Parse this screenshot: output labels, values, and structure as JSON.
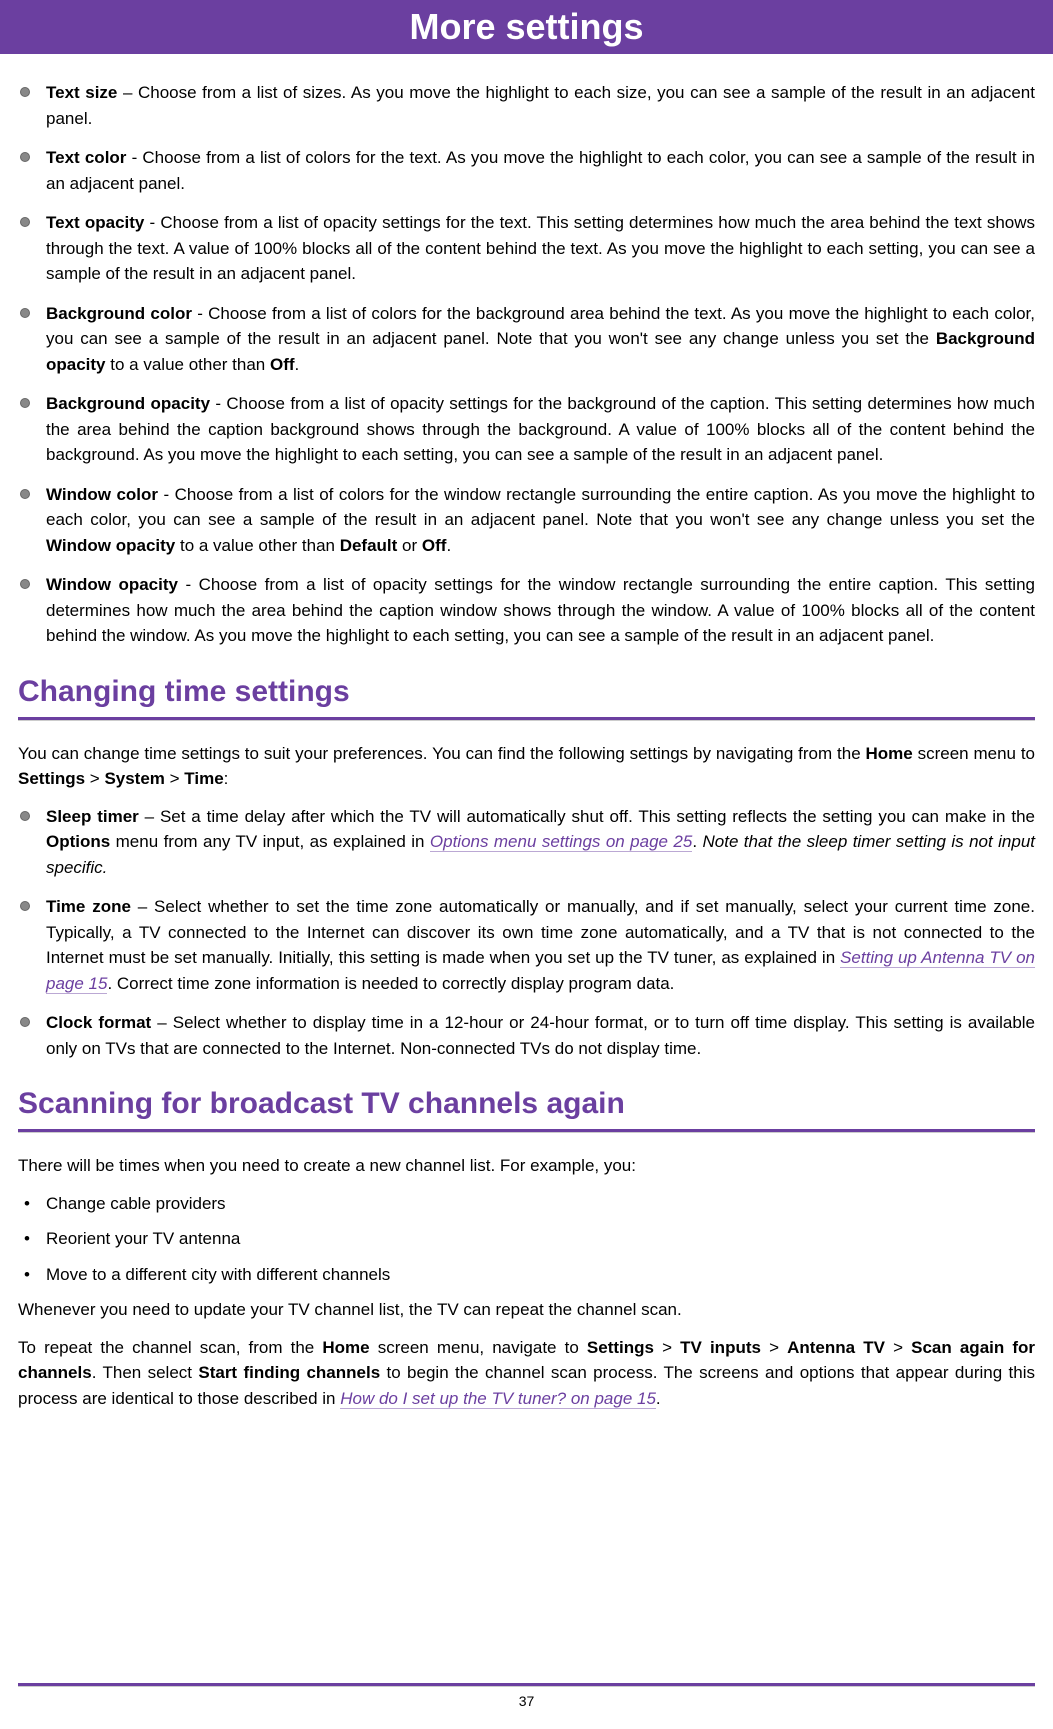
{
  "header": {
    "title": "More settings"
  },
  "section1": {
    "items": [
      {
        "term": "Text size",
        "sep": " – ",
        "body": "Choose from a list of sizes. As you move the highlight to each size, you can see a sample of the result in an adjacent panel."
      },
      {
        "term": "Text color",
        "sep": " - ",
        "body": "Choose from a list of colors for the text. As you move the highlight to each color, you can see a sample of the result in an adjacent panel."
      },
      {
        "term": "Text opacity",
        "sep": " - ",
        "body": "Choose from a list of opacity settings for the text. This setting determines how much the area behind the text shows through the text. A value of 100% blocks all of the content behind the text. As you move the highlight to each setting, you can see a sample of the result in an adjacent panel."
      },
      {
        "term": "Background color",
        "sep": " - ",
        "body1": "Choose from a list of colors for the background area behind the text. As you move the highlight to each color, you can see a sample of the result in an adjacent panel. Note that you won't see any change unless you set the ",
        "bold1": "Background opacity",
        "body2": " to a value other than ",
        "bold2": "Off",
        "body3": "."
      },
      {
        "term": "Background opacity",
        "sep": " - ",
        "body": "Choose from a list of opacity settings for the background of the caption. This setting determines how much the area behind the caption background shows through the background. A value of 100% blocks all of the content behind the background. As you move the highlight to each setting, you can see a sample of the result in an adjacent panel."
      },
      {
        "term": "Window color",
        "sep": " - ",
        "body1": "Choose from a list of colors for the window rectangle surrounding the entire caption. As you move the highlight to each color, you can see a sample of the result in an adjacent panel. Note that you won't see any change unless you set the ",
        "bold1": "Window opacity",
        "body2": " to a value other than ",
        "bold2": "Default",
        "body3": " or ",
        "bold3": "Off",
        "body4": "."
      },
      {
        "term": "Window opacity",
        "sep": " - ",
        "body": "Choose from a list of opacity settings for the window rectangle surrounding the entire caption. This setting determines how much the area behind the caption window shows through the window. A value of 100% blocks all of the content behind the window. As you move the highlight to each setting, you can see a sample of the result in an adjacent panel."
      }
    ]
  },
  "section2": {
    "heading": "Changing time settings",
    "intro1": "You can change time settings to suit your preferences. You can find the following settings by navigating from the ",
    "intro_bold1": "Home",
    "intro2": " screen menu to ",
    "intro_bold2": "Settings",
    "intro3": " > ",
    "intro_bold3": "System",
    "intro4": " > ",
    "intro_bold4": "Time",
    "intro5": ":",
    "items": [
      {
        "term": "Sleep timer",
        "sep": " – ",
        "body1": "Set a time delay after which the TV will automatically shut off. This setting reflects the setting you can make in the ",
        "bold1": "Options",
        "body2": " menu from any TV input, as explained in ",
        "link1": "Options menu settings on page 25",
        "body3": ". ",
        "ital1": "Note that the sleep timer setting is not input specific."
      },
      {
        "term": "Time zone",
        "sep": " – ",
        "body1": "Select whether to set the time zone automatically or manually, and if set manually, select your current time zone. Typically, a TV connected to the Internet can discover its own time zone automatically, and a TV that is not connected to the Internet must be set manually. Initially, this setting is made when you set up the TV tuner, as explained in ",
        "link1": "Setting up Antenna TV on page 15",
        "body2": ". Correct time zone information is needed to correctly display program data."
      },
      {
        "term": "Clock format",
        "sep": " – ",
        "body": "Select whether to display time in a 12-hour or 24-hour format, or to turn off time display. This setting is available only on TVs that are connected to the Internet. Non-connected TVs do not display time."
      }
    ]
  },
  "section3": {
    "heading": "Scanning for broadcast TV channels again",
    "intro": "There will be times when you need to create a new channel list. For example, you:",
    "items": [
      "Change cable providers",
      "Reorient your TV antenna",
      "Move to a different city with different channels"
    ],
    "followup": "Whenever you need to update your TV channel list, the TV can repeat the channel scan.",
    "p2_1": "To repeat the channel scan, from the ",
    "p2_b1": "Home",
    "p2_2": " screen menu, navigate to ",
    "p2_b2": "Settings",
    "p2_3": " > ",
    "p2_b3": "TV inputs",
    "p2_4": " > ",
    "p2_b4": "Antenna TV",
    "p2_5": " > ",
    "p2_b5": "Scan again for channels",
    "p2_6": ". Then select ",
    "p2_b6": "Start finding channels",
    "p2_7": " to begin the channel scan process. The screens and options that appear during this process are identical to those described in ",
    "p2_link": "How do I set up the TV tuner? on page 15",
    "p2_8": "."
  },
  "footer": {
    "page": "37"
  }
}
